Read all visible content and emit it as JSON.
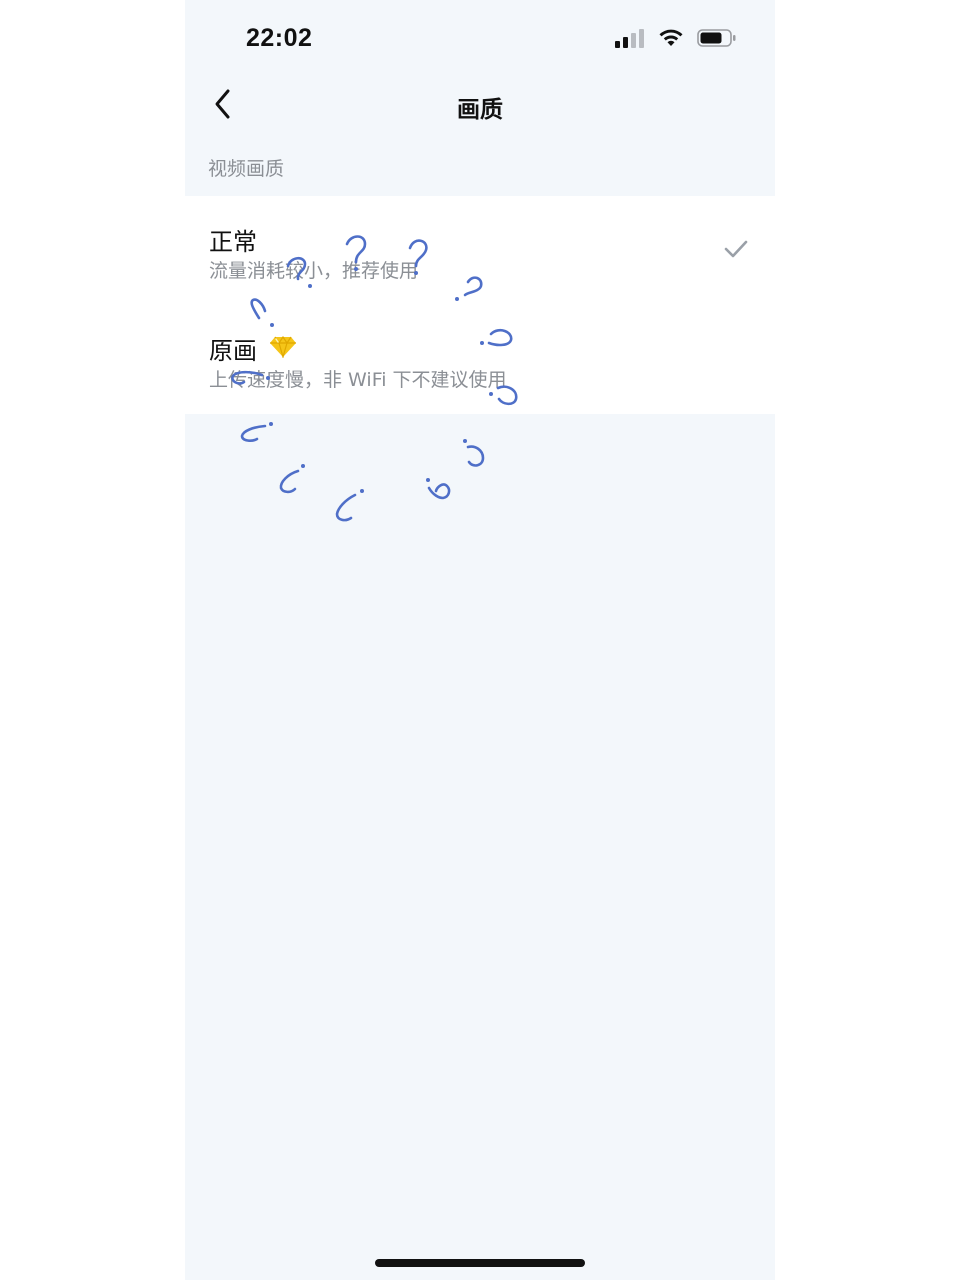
{
  "status_bar": {
    "time": "22:02",
    "icons": [
      "cellular-signal-icon",
      "wifi-icon",
      "battery-icon"
    ]
  },
  "nav": {
    "back_icon": "chevron-left-icon",
    "title": "画质"
  },
  "section": {
    "header": "视频画质"
  },
  "options": [
    {
      "title": "正常",
      "description": "流量消耗较小，推荐使用",
      "selected": true
    },
    {
      "title": "原画",
      "badge_icon": "diamond-icon",
      "description": "上传速度慢，非 WiFi 下不建议使用",
      "selected": false
    }
  ],
  "colors": {
    "background": "#f3f7fb",
    "card": "#ffffff",
    "text_primary": "#111111",
    "text_secondary": "#8b8f95",
    "check": "#9aa0a8",
    "diamond": "#f5c518",
    "doodle": "#4f6fc8"
  }
}
